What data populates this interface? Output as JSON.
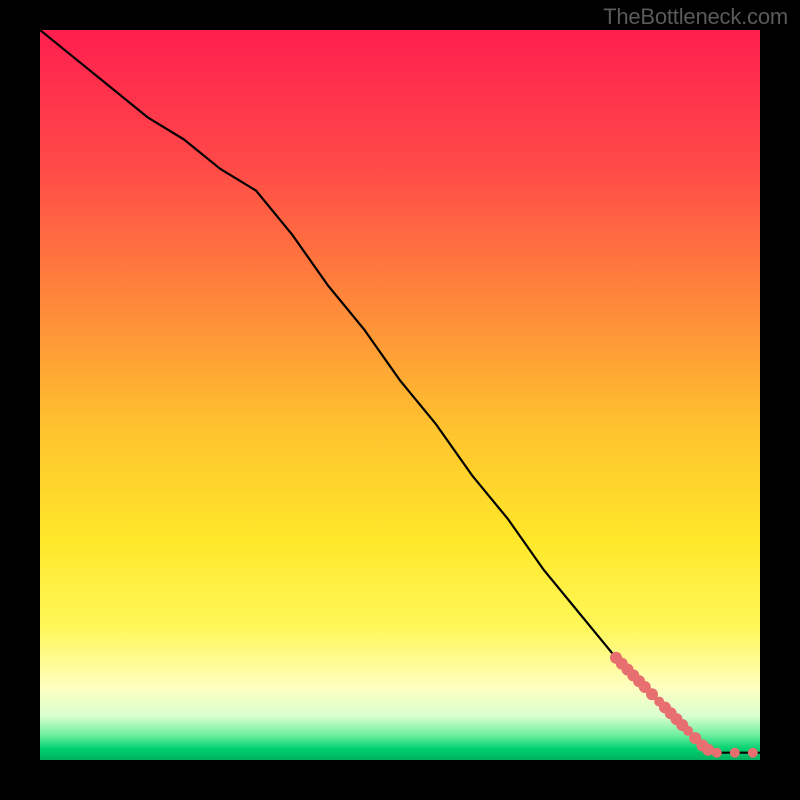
{
  "attribution": "TheBottleneck.com",
  "chart_data": {
    "type": "line",
    "title": "",
    "xlabel": "",
    "ylabel": "",
    "xlim": [
      0,
      100
    ],
    "ylim": [
      0,
      100
    ],
    "background_gradient_stops": [
      {
        "offset": 0.0,
        "color": "#ff1f4f"
      },
      {
        "offset": 0.18,
        "color": "#ff4848"
      },
      {
        "offset": 0.38,
        "color": "#ff8a3a"
      },
      {
        "offset": 0.55,
        "color": "#ffc42e"
      },
      {
        "offset": 0.7,
        "color": "#ffe82a"
      },
      {
        "offset": 0.82,
        "color": "#fff85a"
      },
      {
        "offset": 0.9,
        "color": "#ffffc0"
      },
      {
        "offset": 0.94,
        "color": "#d9ffd0"
      },
      {
        "offset": 0.965,
        "color": "#70f0a0"
      },
      {
        "offset": 0.985,
        "color": "#00d070"
      },
      {
        "offset": 1.0,
        "color": "#00b060"
      }
    ],
    "series": [
      {
        "name": "bottleneck-curve",
        "color": "#000000",
        "x": [
          0,
          5,
          10,
          15,
          20,
          25,
          30,
          35,
          40,
          45,
          50,
          55,
          60,
          65,
          70,
          75,
          80,
          82,
          84,
          86,
          88,
          90,
          92,
          94,
          96,
          98,
          100
        ],
        "y": [
          100,
          96,
          92,
          88,
          85,
          81,
          78,
          72,
          65,
          59,
          52,
          46,
          39,
          33,
          26,
          20,
          14,
          12,
          10,
          8,
          6,
          4,
          2,
          1,
          1,
          1,
          1
        ]
      }
    ],
    "markers": {
      "name": "highlight-dots",
      "color": "#e76f6f",
      "radius": 6,
      "points": [
        {
          "x": 80.0,
          "y": 14.0,
          "r": 6
        },
        {
          "x": 80.8,
          "y": 13.2,
          "r": 6
        },
        {
          "x": 81.6,
          "y": 12.4,
          "r": 6
        },
        {
          "x": 82.4,
          "y": 11.6,
          "r": 6
        },
        {
          "x": 83.2,
          "y": 10.8,
          "r": 6
        },
        {
          "x": 84.0,
          "y": 10.0,
          "r": 6
        },
        {
          "x": 85.0,
          "y": 9.0,
          "r": 6
        },
        {
          "x": 86.0,
          "y": 8.0,
          "r": 5
        },
        {
          "x": 86.8,
          "y": 7.2,
          "r": 6
        },
        {
          "x": 87.6,
          "y": 6.4,
          "r": 6
        },
        {
          "x": 88.4,
          "y": 5.6,
          "r": 6
        },
        {
          "x": 89.2,
          "y": 4.8,
          "r": 6
        },
        {
          "x": 90.0,
          "y": 4.0,
          "r": 5
        },
        {
          "x": 91.0,
          "y": 3.0,
          "r": 6
        },
        {
          "x": 92.0,
          "y": 2.0,
          "r": 6
        },
        {
          "x": 92.8,
          "y": 1.4,
          "r": 6
        },
        {
          "x": 94.0,
          "y": 1.0,
          "r": 5
        },
        {
          "x": 96.5,
          "y": 1.0,
          "r": 5
        },
        {
          "x": 99.0,
          "y": 1.0,
          "r": 5
        }
      ]
    }
  }
}
